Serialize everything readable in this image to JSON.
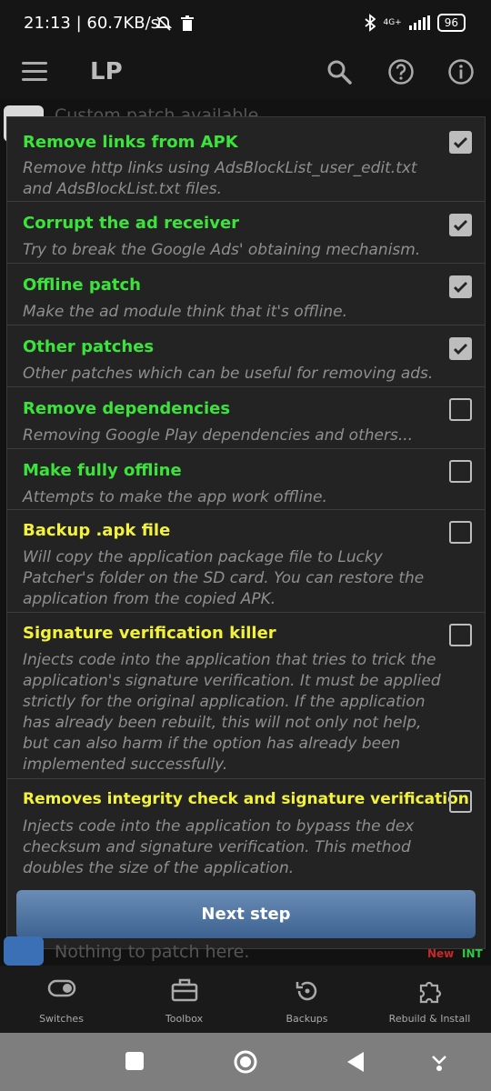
{
  "status": {
    "time": "21:13 | 60.7KB/s",
    "network": "4G+",
    "battery": "96"
  },
  "appbar": {
    "title": "LP"
  },
  "background": {
    "top_item": "Custom patch available",
    "bottom_item": "Nothing to patch here.",
    "new_label": "New",
    "int_label": "INT"
  },
  "options": [
    {
      "title": "Remove links from APK",
      "desc": "Remove http links using AdsBlockList_user_edit.txt and AdsBlockList.txt files.",
      "checked": true,
      "color": "#3be33b"
    },
    {
      "title": "Corrupt the ad receiver",
      "desc": "Try to break the Google Ads' obtaining mechanism.",
      "checked": true,
      "color": "#3be33b"
    },
    {
      "title": "Offline patch",
      "desc": "Make the ad module think that it's offline.",
      "checked": true,
      "color": "#3be33b"
    },
    {
      "title": "Other patches",
      "desc": "Other patches which can be useful for removing ads.",
      "checked": true,
      "color": "#3be33b"
    },
    {
      "title": "Remove dependencies",
      "desc": "Removing Google Play dependencies and others...",
      "checked": false,
      "color": "#3be33b"
    },
    {
      "title": "Make fully offline",
      "desc": "Attempts to make the app work offline.",
      "checked": false,
      "color": "#3be33b"
    },
    {
      "title": "Backup .apk file",
      "desc": "Will copy the application package file to Lucky Patcher's folder on the SD card. You can restore the application from the copied APK.",
      "checked": false,
      "color": "#f2f23c"
    },
    {
      "title": "Signature verification killer",
      "desc": "Injects code into the application that tries to trick the application's signature verification. It must be applied strictly for the original application. If the application has already been rebuilt, this will not only not help, but can also harm if the option has already been implemented successfully.",
      "checked": false,
      "color": "#f2f23c"
    },
    {
      "title": "Removes integrity check and signature verification",
      "desc": "Injects code into the application to bypass the dex checksum and signature verification. This method doubles the size of the application.",
      "checked": false,
      "color": "#f2f23c"
    }
  ],
  "next_button": "Next step",
  "bottom_nav": [
    {
      "label": "Switches",
      "icon": "toggle-icon"
    },
    {
      "label": "Toolbox",
      "icon": "toolbox-icon"
    },
    {
      "label": "Backups",
      "icon": "backup-icon"
    },
    {
      "label": "Rebuild & Install",
      "icon": "puzzle-icon"
    }
  ]
}
